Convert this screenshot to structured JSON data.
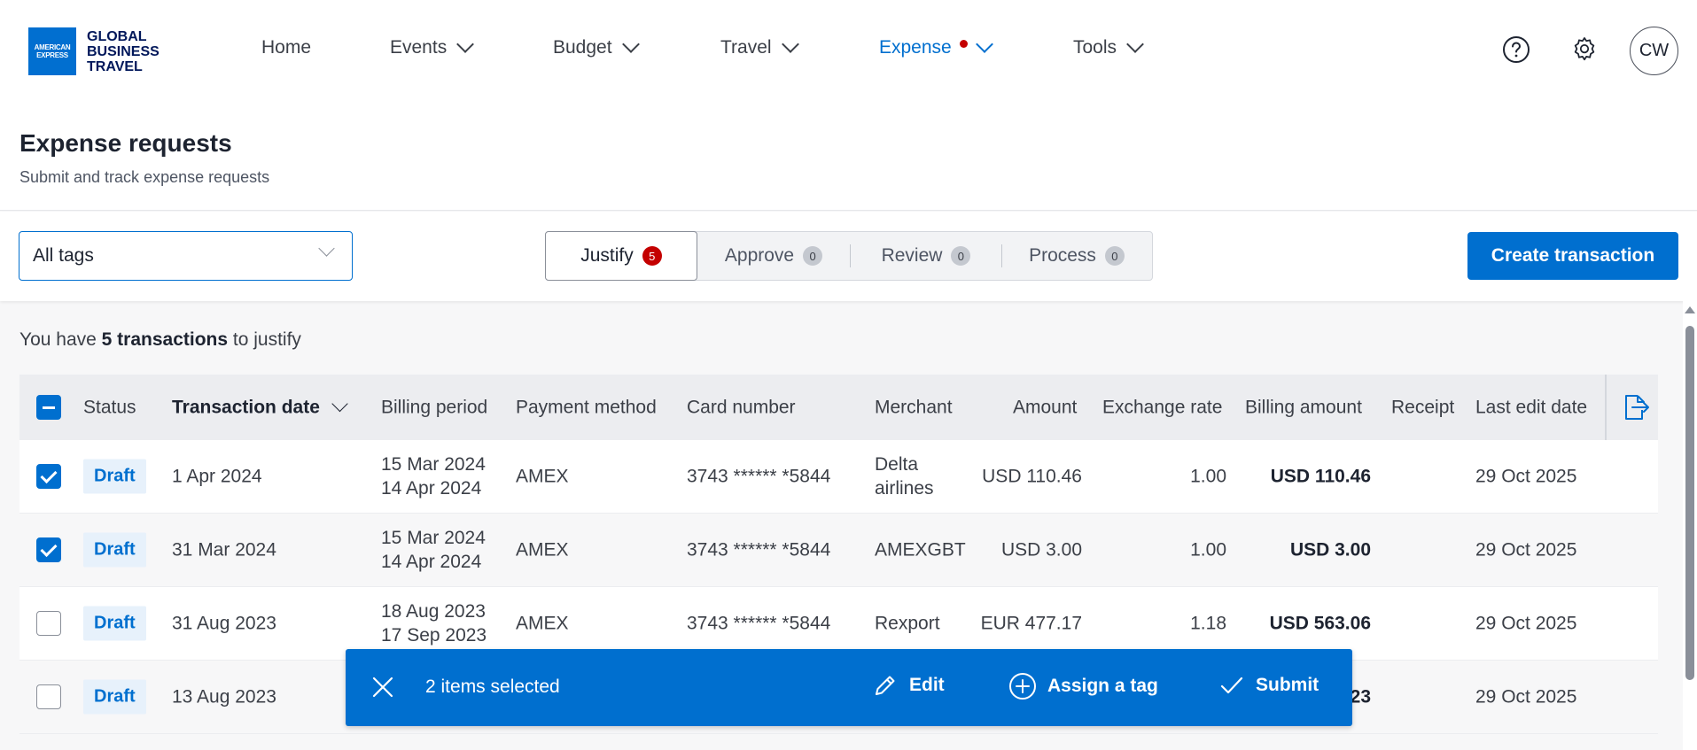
{
  "brand": {
    "logo_line1": "AMERICAN",
    "logo_line2": "EXPRESS",
    "name_lines": [
      "GLOBAL",
      "BUSINESS",
      "TRAVEL"
    ]
  },
  "nav": {
    "items": [
      {
        "label": "Home",
        "has_menu": false
      },
      {
        "label": "Events",
        "has_menu": true
      },
      {
        "label": "Budget",
        "has_menu": true
      },
      {
        "label": "Travel",
        "has_menu": true
      },
      {
        "label": "Expense",
        "has_menu": true,
        "active": true,
        "notification": true
      },
      {
        "label": "Tools",
        "has_menu": true
      }
    ],
    "help_icon": "help-circle-icon",
    "settings_icon": "gear-icon",
    "avatar_initials": "CW"
  },
  "page": {
    "title": "Expense requests",
    "subtitle": "Submit and track expense requests"
  },
  "filters": {
    "tag_select_value": "All tags",
    "tabs": [
      {
        "label": "Justify",
        "count": "5",
        "selected": true
      },
      {
        "label": "Approve",
        "count": "0"
      },
      {
        "label": "Review",
        "count": "0"
      },
      {
        "label": "Process",
        "count": "0"
      }
    ],
    "create_button": "Create transaction"
  },
  "summary": {
    "prefix": "You have ",
    "count_text": "5 transactions",
    "suffix": " to justify"
  },
  "table": {
    "columns": [
      "Status",
      "Transaction date",
      "Billing period",
      "Payment method",
      "Card number",
      "Merchant",
      "Amount",
      "Exchange rate",
      "Billing amount",
      "Receipt",
      "Last edit date"
    ],
    "rows": [
      {
        "checked": true,
        "status": "Draft",
        "date": "1 Apr 2024",
        "period_start": "15 Mar 2024",
        "period_end": "14 Apr 2024",
        "method": "AMEX",
        "card": "3743 ****** *5844",
        "merchant_1": "Delta",
        "merchant_2": "airlines",
        "amount": "USD 110.46",
        "rate": "1.00",
        "billing": "USD 110.46",
        "receipt": "",
        "edited": "29 Oct 2025"
      },
      {
        "checked": true,
        "status": "Draft",
        "date": "31 Mar 2024",
        "period_start": "15 Mar 2024",
        "period_end": "14 Apr 2024",
        "method": "AMEX",
        "card": "3743 ****** *5844",
        "merchant_1": "AMEXGBT",
        "merchant_2": "",
        "amount": "USD 3.00",
        "rate": "1.00",
        "billing": "USD 3.00",
        "receipt": "",
        "edited": "29 Oct 2025"
      },
      {
        "checked": false,
        "status": "Draft",
        "date": "31 Aug 2023",
        "period_start": "18 Aug 2023",
        "period_end": "17 Sep 2023",
        "method": "AMEX",
        "card": "3743 ****** *5844",
        "merchant_1": "Rexport",
        "merchant_2": "",
        "amount": "EUR 477.17",
        "rate": "1.18",
        "billing": "USD 563.06",
        "receipt": "",
        "edited": "29 Oct 2025"
      },
      {
        "checked": false,
        "status": "Draft",
        "date": "13 Aug 2023",
        "period_start": "",
        "period_end": "",
        "method": "",
        "card": "",
        "merchant_1": "",
        "merchant_2": "",
        "amount": "",
        "rate": "",
        "billing": "23",
        "receipt": "",
        "edited": "29 Oct 2025"
      }
    ]
  },
  "action_bar": {
    "selected_text": "2 items selected",
    "edit": "Edit",
    "assign_tag": "Assign a tag",
    "submit": "Submit"
  },
  "colors": {
    "primary": "#006fcf",
    "alert": "#c40000",
    "brand_blue": "#016fd0"
  }
}
